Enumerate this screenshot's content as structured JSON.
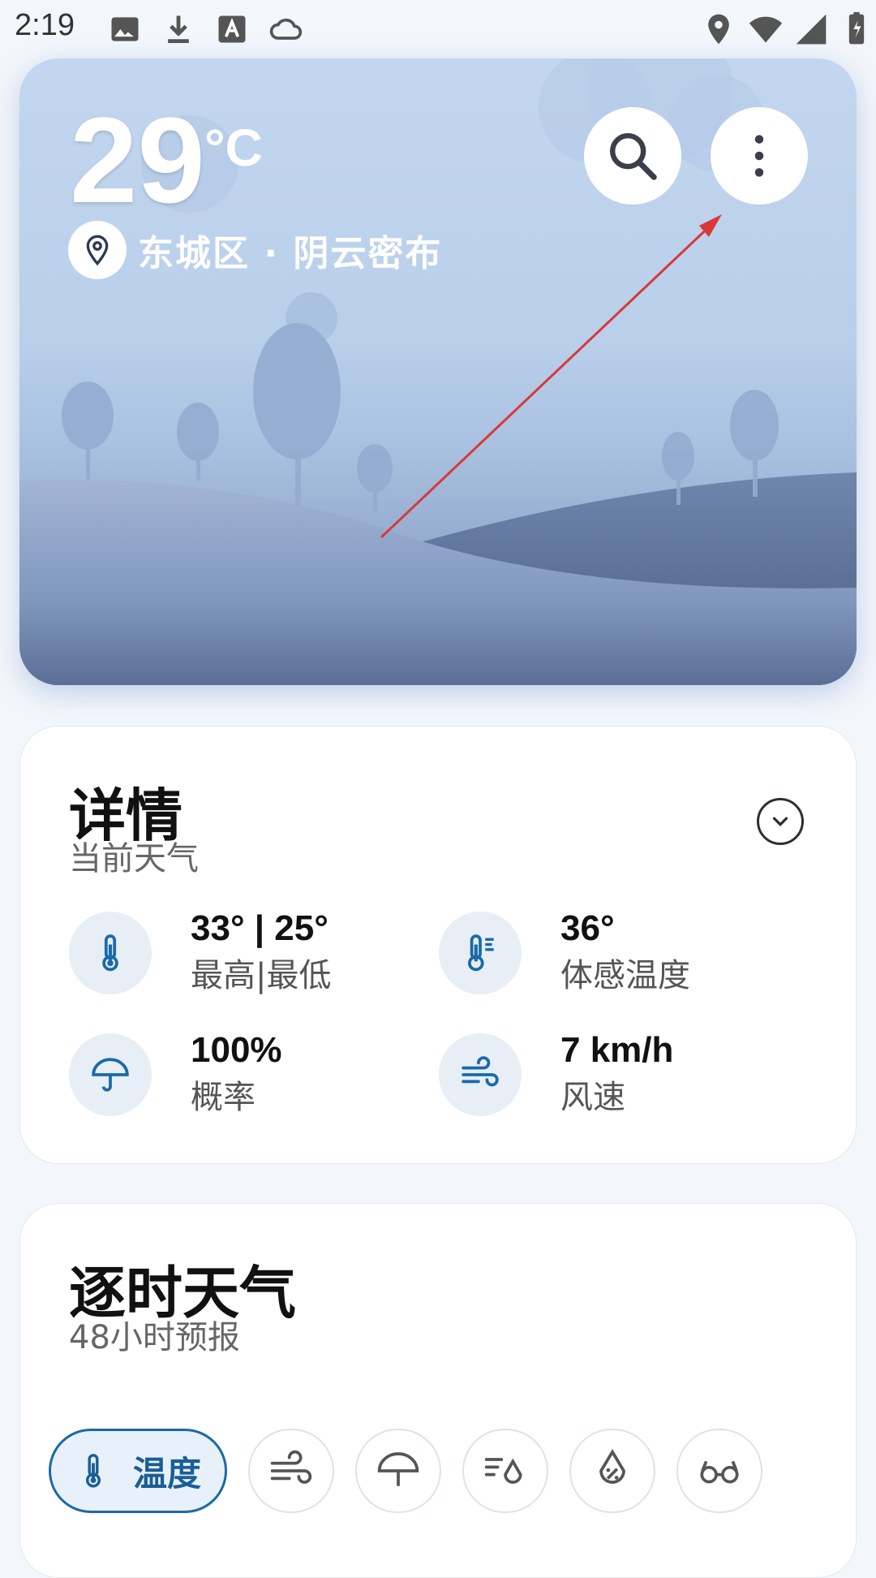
{
  "status_bar": {
    "time": "2:19",
    "left_icons": [
      "image-icon",
      "download-icon",
      "font-icon",
      "cloud-icon"
    ],
    "right_icons": [
      "location-icon",
      "wifi-icon",
      "signal-icon",
      "battery-icon"
    ]
  },
  "hero": {
    "temperature": "29",
    "unit": "°C",
    "location_line": "东城区 · 阴云密布",
    "search_icon": "search-icon",
    "menu_icon": "more-vert-icon"
  },
  "details": {
    "title": "详情",
    "subtitle": "当前天气",
    "items": [
      {
        "value": "33° | 25°",
        "label": "最高|最低",
        "icon": "thermometer-icon"
      },
      {
        "value": "36°",
        "label": "体感温度",
        "icon": "feels-like-icon"
      },
      {
        "value": "100%",
        "label": "概率",
        "icon": "umbrella-icon"
      },
      {
        "value": "7 km/h",
        "label": "风速",
        "icon": "wind-icon"
      }
    ]
  },
  "hourly": {
    "title": "逐时天气",
    "subtitle": "48小时预报",
    "tabs": [
      {
        "label": "温度",
        "icon": "thermometer-icon",
        "active": true
      },
      {
        "label": "",
        "icon": "wind-icon"
      },
      {
        "label": "",
        "icon": "umbrella-icon"
      },
      {
        "label": "",
        "icon": "rain-icon"
      },
      {
        "label": "",
        "icon": "humidity-icon"
      },
      {
        "label": "",
        "icon": "visibility-icon"
      }
    ]
  },
  "colors": {
    "accent": "#1a6aa8",
    "hero_sky": "#c3d6ef",
    "hero_hill": "#6f83aa"
  }
}
